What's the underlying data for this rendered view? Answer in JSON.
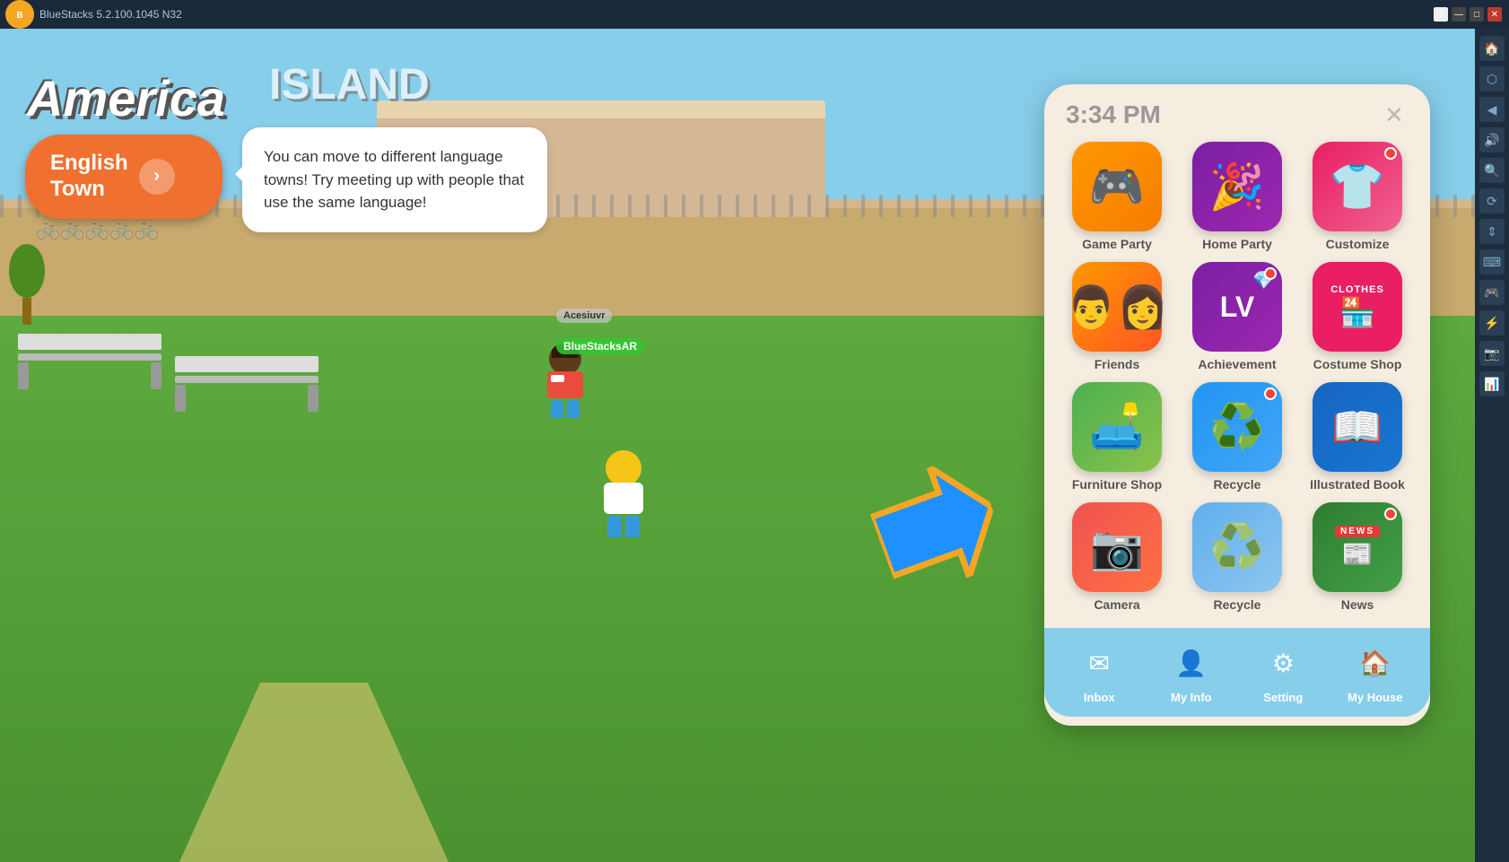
{
  "titlebar": {
    "app_name": "BlueStacks 5.2.100.1045  N32",
    "logo": "B",
    "buttons": {
      "help": "?",
      "minimize": "—",
      "maximize": "□",
      "close": "✕"
    }
  },
  "game": {
    "region": "America",
    "island": "ISLAND",
    "english_town_btn": "English\nTown",
    "arrow": "›",
    "speech_bubble": "You can move to different language towns! Try meeting up with people that use the same language!",
    "player_name": "BlueStacksAR",
    "npc_name": "Acesiuvr",
    "time": "3:34 PM"
  },
  "menu": {
    "close_btn": "✕",
    "time": "3:34 PM",
    "items": [
      {
        "id": "game-party",
        "label": "Game Party",
        "icon": "🎮",
        "color_class": "icon-game-party",
        "has_badge": false
      },
      {
        "id": "home-party",
        "label": "Home Party",
        "icon": "🎉",
        "color_class": "icon-home-party",
        "has_badge": false
      },
      {
        "id": "customize",
        "label": "Customize",
        "icon": "👕",
        "color_class": "icon-customize",
        "has_badge": true
      },
      {
        "id": "friends",
        "label": "Friends",
        "icon": "👫",
        "color_class": "icon-friends",
        "has_badge": false
      },
      {
        "id": "achievement",
        "label": "Achievement",
        "icon": "LV",
        "color_class": "icon-achievement",
        "has_badge": true
      },
      {
        "id": "costume-shop",
        "label": "Costume Shop",
        "icon": "🏪",
        "color_class": "icon-costume-shop",
        "has_badge": false
      },
      {
        "id": "furniture-shop",
        "label": "Furniture Shop",
        "icon": "🛋️",
        "color_class": "icon-furniture",
        "has_badge": false
      },
      {
        "id": "recycle",
        "label": "Recycle",
        "icon": "♻️",
        "color_class": "icon-recycle",
        "has_badge": true
      },
      {
        "id": "illustrated-book",
        "label": "Illustrated Book",
        "icon": "📖",
        "color_class": "icon-illustrated",
        "has_badge": false
      },
      {
        "id": "camera",
        "label": "Camera",
        "icon": "📷",
        "color_class": "icon-camera",
        "has_badge": false
      },
      {
        "id": "recycle2",
        "label": "Recycle",
        "icon": "♻️",
        "color_class": "icon-recycle2",
        "has_badge": false
      },
      {
        "id": "news",
        "label": "News",
        "icon": "📰",
        "color_class": "icon-news",
        "has_badge": true
      }
    ],
    "bottom": [
      {
        "id": "inbox",
        "label": "Inbox",
        "icon": "✉"
      },
      {
        "id": "my-info",
        "label": "My Info",
        "icon": "👤"
      },
      {
        "id": "setting",
        "label": "Setting",
        "icon": "⚙"
      },
      {
        "id": "my-house",
        "label": "My House",
        "icon": "🏠"
      }
    ]
  },
  "sidebar": {
    "icons": [
      "?",
      "≡",
      "🔗",
      "◉",
      "👁",
      "🔄",
      "↕",
      "⌨",
      "🎮",
      "⚡",
      "📷",
      "📊"
    ]
  }
}
